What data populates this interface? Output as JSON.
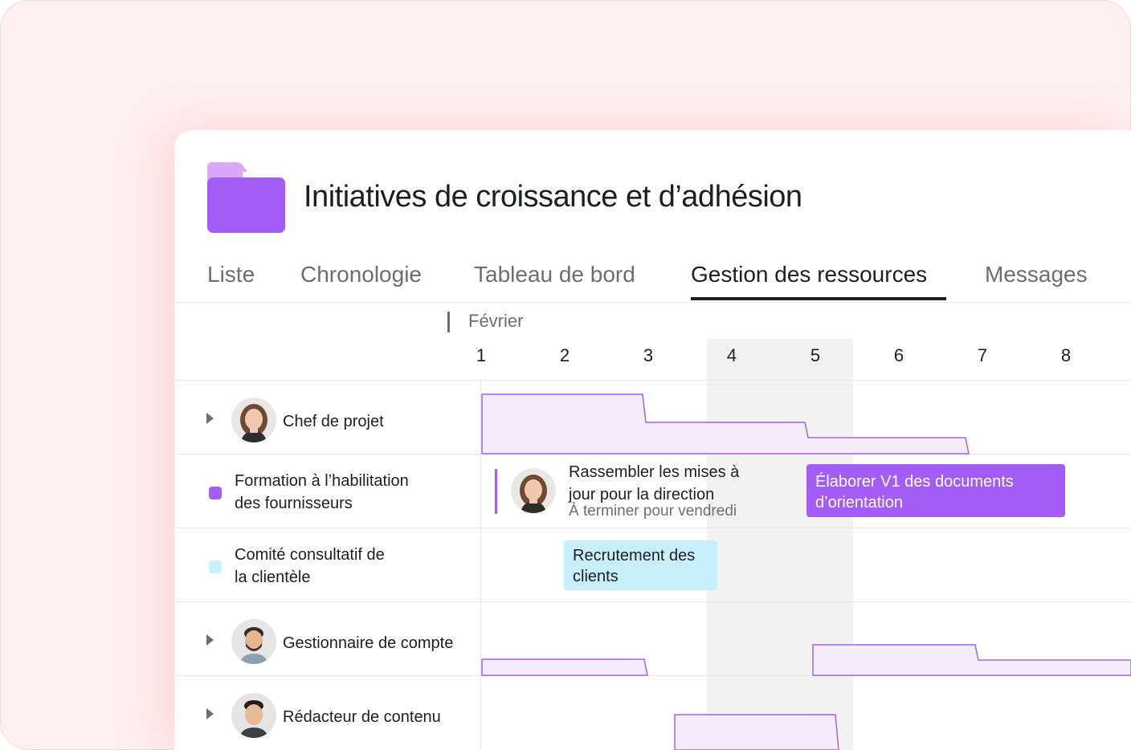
{
  "project": {
    "title": "Initiatives de croissance et d’adhésion",
    "folder_color": "#a35cf5"
  },
  "tabs": [
    {
      "label": "Liste"
    },
    {
      "label": "Chronologie"
    },
    {
      "label": "Tableau de bord"
    },
    {
      "label": "Gestion des ressources",
      "active": true
    },
    {
      "label": "Messages"
    }
  ],
  "timeline": {
    "month": "Février",
    "days": [
      "1",
      "2",
      "3",
      "4",
      "5",
      "6",
      "7",
      "8"
    ]
  },
  "rows": {
    "chef": {
      "label": "Chef de projet",
      "icon": "chevron-right-icon"
    },
    "formation": {
      "line1": "Formation à l’habilitation",
      "line2": "des fournisseurs",
      "color": "#a35cf5"
    },
    "comite": {
      "line1": "Comité consultatif de",
      "line2": "la clientèle",
      "color": "#c7f0fc"
    },
    "gestionnaire": {
      "label": "Gestionnaire de compte",
      "icon": "chevron-right-icon"
    },
    "redacteur": {
      "label": "Rédacteur de contenu",
      "icon": "chevron-right-icon"
    }
  },
  "tasks": {
    "rassembler": {
      "line1": "Rassembler les mises à",
      "line2": "jour pour la direction",
      "due": "À terminer pour vendredi"
    },
    "elaborer": {
      "line1": "Élaborer V1 des documents",
      "line2": "d’orientation",
      "color": "#a35cf5"
    },
    "recrutement": {
      "line1": "Recrutement des",
      "line2": "clients",
      "color": "#c7f0fc"
    }
  },
  "colors": {
    "accent": "#a35cf5",
    "workload_fill": "#f4ecfd",
    "workload_line": "#a162f0",
    "weekend": "#f3f2f2"
  }
}
